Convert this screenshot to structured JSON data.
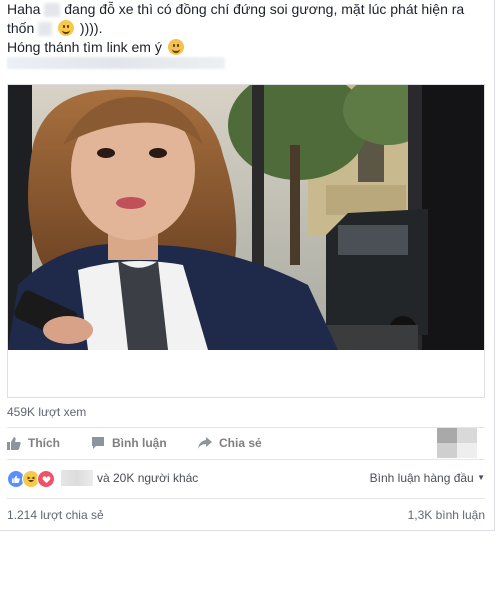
{
  "post": {
    "line1_a": "Haha",
    "line1_b": "đang đỗ xe thì có đồng chí đứng soi gương, mặt lúc phát hiện ra",
    "line2_a": "thốn",
    "line2_b": ")))).",
    "line3": "Hóng thánh tìm link em ý"
  },
  "video": {
    "views": "459K lượt xem"
  },
  "actions": {
    "like": "Thích",
    "comment": "Bình luận",
    "share": "Chia sẻ"
  },
  "reactions": {
    "others": "và 20K người khác",
    "sort": "Bình luận hàng đầu"
  },
  "stats": {
    "shares": "1.214 lượt chia sẻ",
    "comments": "1,3K bình luận"
  },
  "colors": {
    "like_blue": "#5890ff",
    "haha_yellow": "#f7c948",
    "love_red": "#f25268",
    "muted_text": "#606770"
  }
}
